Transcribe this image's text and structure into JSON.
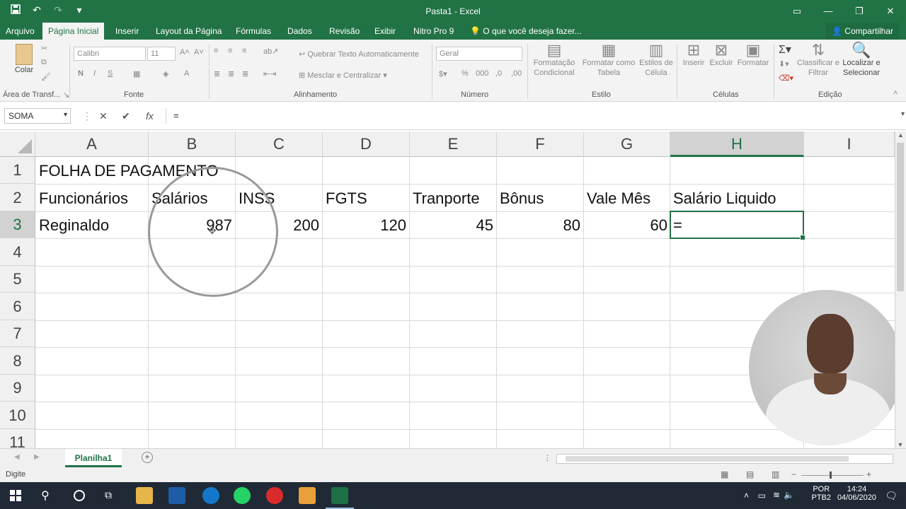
{
  "title_bar": {
    "title": "Pasta1  -  Excel",
    "qat_icons": [
      "save-icon",
      "undo-icon",
      "redo-icon",
      "customize-icon"
    ],
    "controls": [
      "ribbon-display-icon",
      "minimize-icon",
      "maximize-icon",
      "close-icon"
    ]
  },
  "menu": {
    "tabs": [
      "Arquivo",
      "Página Inicial",
      "Inserir",
      "Layout da Página",
      "Fórmulas",
      "Dados",
      "Revisão",
      "Exibir",
      "Nitro Pro 9"
    ],
    "tell_me": "O que você deseja fazer...",
    "share": "Compartilhar",
    "active_tab": "Página Inicial"
  },
  "ribbon": {
    "clipboard": {
      "paste": "Colar",
      "label": "Área de Transf..."
    },
    "font": {
      "name": "Calibri",
      "size": "11",
      "bold": "N",
      "italic": "I",
      "underline": "S",
      "label": "Fonte"
    },
    "alignment": {
      "wrap": "Quebrar Texto Automaticamente",
      "merge": "Mesclar e Centralizar",
      "label": "Alinhamento"
    },
    "number": {
      "format": "Geral",
      "label": "Número"
    },
    "styles": {
      "conditional": "Formatação Condicional",
      "as_table": "Formatar como Tabela",
      "cell_styles": "Estilos de Célula",
      "label": "Estilo"
    },
    "cells": {
      "insert": "Inserir",
      "delete": "Excluir",
      "format": "Formatar",
      "label": "Células"
    },
    "editing": {
      "sort": "Classificar e Filtrar",
      "find": "Localizar e Selecionar",
      "label": "Edição"
    }
  },
  "formula_bar": {
    "name_box": "SOMA",
    "cancel": "✕",
    "enter": "✔",
    "fx": "fx",
    "value": "="
  },
  "sheet": {
    "columns": [
      "A",
      "B",
      "C",
      "D",
      "E",
      "F",
      "G",
      "H",
      "I"
    ],
    "rows": [
      "1",
      "2",
      "3",
      "4",
      "5",
      "6",
      "7",
      "8",
      "9",
      "10",
      "11"
    ],
    "cells": {
      "A1": "FOLHA DE PAGAMENTO",
      "A2": "Funcionários",
      "B2": "Salários",
      "C2": "INSS",
      "D2": "FGTS",
      "E2": "Tranporte",
      "F2": "Bônus",
      "G2": "Vale Mês",
      "H2": "Salário Liquido",
      "A3": "Reginaldo",
      "B3": "987",
      "C3": "200",
      "D3": "120",
      "E3": "45",
      "F3": "80",
      "G3": "60",
      "H3": "="
    },
    "selected_column": "H",
    "selected_row": "3"
  },
  "sheet_tabs": {
    "tabs": [
      "Planilha1"
    ],
    "add": "+"
  },
  "status": {
    "mode": "Digite"
  },
  "taskbar": {
    "language": "POR",
    "layout": "PTB2",
    "time": "14:24",
    "date": "04/06/2020"
  }
}
